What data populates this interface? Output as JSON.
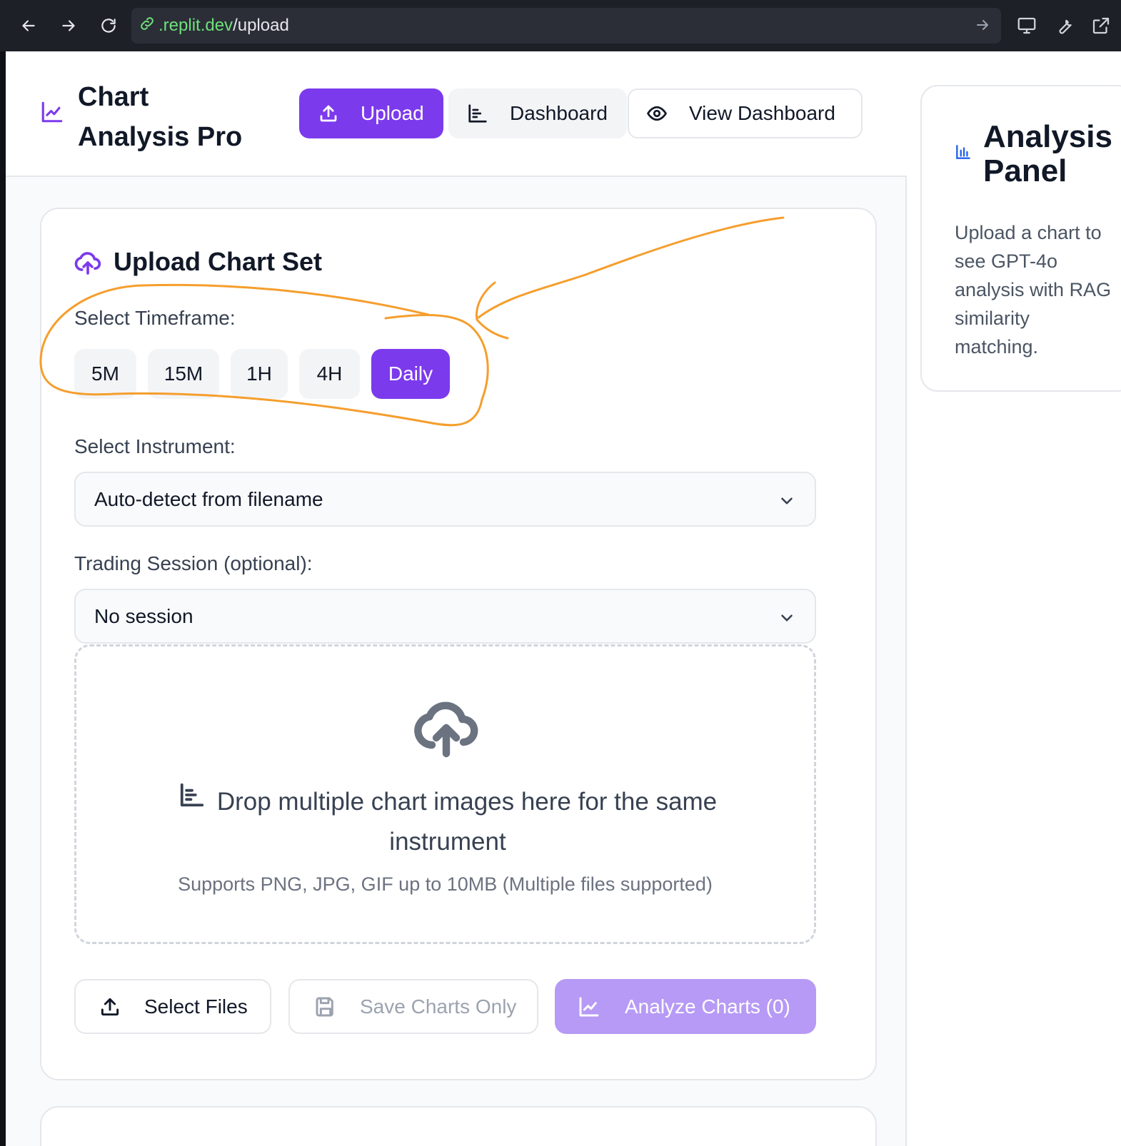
{
  "browser": {
    "url_host": ".replit.dev",
    "url_path": "/upload"
  },
  "header": {
    "title": "Chart Analysis Pro",
    "tabs": {
      "upload": "Upload",
      "dashboard": "Dashboard",
      "view_dashboard": "View Dashboard"
    }
  },
  "upload_card": {
    "title": "Upload Chart Set",
    "timeframe_label": "Select Timeframe:",
    "timeframes": [
      "5M",
      "15M",
      "1H",
      "4H",
      "Daily"
    ],
    "selected_timeframe": "Daily",
    "instrument_label": "Select Instrument:",
    "instrument_value": "Auto-detect from filename",
    "session_label": "Trading Session (optional):",
    "session_value": "No session",
    "dropzone": {
      "title": "Drop multiple chart images here for the same instrument",
      "subtitle": "Supports PNG, JPG, GIF up to 10MB (Multiple files supported)"
    },
    "buttons": {
      "select_files": "Select Files",
      "save_charts": "Save Charts Only",
      "analyze": "Analyze Charts (0)"
    }
  },
  "analysis_panel": {
    "title": "Analysis Panel",
    "description_lines": [
      "Upload a chart to",
      "see GPT-4o",
      "analysis with RAG",
      "similarity",
      "matching."
    ]
  },
  "colors": {
    "accent": "#7c3aed",
    "accent_disabled": "#b69af5",
    "annotation": "#f59e2d"
  }
}
